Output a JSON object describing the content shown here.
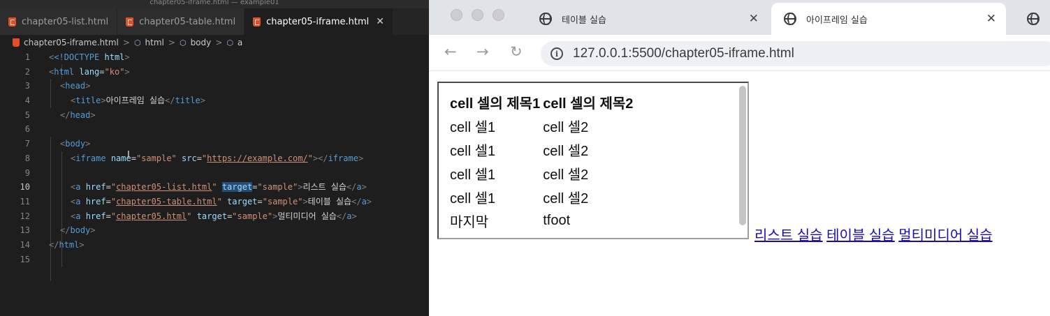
{
  "editor": {
    "window_title": "chapter05-iframe.html — example01",
    "tabs": [
      {
        "label": "chapter05-list.html"
      },
      {
        "label": "chapter05-table.html"
      },
      {
        "label": "chapter05-iframe.html",
        "close": "✕"
      }
    ],
    "breadcrumb": {
      "file": "chapter05-iframe.html",
      "items": [
        "html",
        "body",
        "a"
      ],
      "sep": ">"
    },
    "line_numbers": [
      "1",
      "2",
      "3",
      "4",
      "5",
      "6",
      "7",
      "8",
      "9",
      "10",
      "11",
      "12",
      "13",
      "14",
      "15"
    ],
    "code": {
      "l1": {
        "doctype": "<!DOCTYPE",
        "html": "html",
        "end": ">"
      },
      "l2": {
        "tag": "html",
        "attr": "lang",
        "val": "\"ko\""
      },
      "l3": {
        "tag": "head"
      },
      "l4": {
        "tag": "title",
        "text": "아이프레임 실습",
        "close": "title"
      },
      "l5": {
        "close": "head"
      },
      "l7": {
        "tag": "body"
      },
      "l8": {
        "tag": "iframe",
        "attr1": "name",
        "val1": "\"sample\"",
        "attr2": "src",
        "val2_q": "\"",
        "val2": "https://example.com/",
        "val2_q2": "\"",
        "close": "iframe"
      },
      "l10": {
        "tag": "a",
        "attr1": "href",
        "q": "\"",
        "val1": "chapter05-list.html",
        "attr2": "target",
        "val2": "\"sample\"",
        "text": "리스트 실습",
        "close": "a"
      },
      "l11": {
        "tag": "a",
        "attr1": "href",
        "q": "\"",
        "val1": "chapter05-table.html",
        "attr2": "target",
        "val2": "\"sample\"",
        "text": "테이블 실습",
        "close": "a"
      },
      "l12": {
        "tag": "a",
        "attr1": "href",
        "q": "\"",
        "val1": "chapter05.html",
        "attr2": "target",
        "val2": "\"sample\"",
        "text": "멀티미디어 실습",
        "close": "a"
      },
      "l13": {
        "close": "body"
      },
      "l14": {
        "close": "html"
      }
    }
  },
  "browser": {
    "tabs": [
      {
        "label": "테이블 실습",
        "close": "✕"
      },
      {
        "label": "아이프레임 실습",
        "close": "✕"
      }
    ],
    "nav": {
      "back": "←",
      "forward": "→",
      "reload": "↻"
    },
    "url": "127.0.0.1:5500/chapter05-iframe.html",
    "iframe_table": {
      "headers": [
        "cell 셀의 제목1",
        "cell 셀의 제목2"
      ],
      "rows": [
        [
          "cell 셀1",
          "cell 셀2"
        ],
        [
          "cell 셀1",
          "cell 셀2"
        ],
        [
          "cell 셀1",
          "cell 셀2"
        ],
        [
          "cell 셀1",
          "cell 셀2"
        ],
        [
          "마지막",
          "tfoot"
        ]
      ]
    },
    "links": [
      "리스트 실습",
      "테이블 실습",
      "멀티미디어 실습"
    ]
  },
  "colors": {
    "tag": "#569cd6",
    "attr": "#9cdcfe",
    "string": "#ce9178",
    "link": "#1a0dab"
  }
}
